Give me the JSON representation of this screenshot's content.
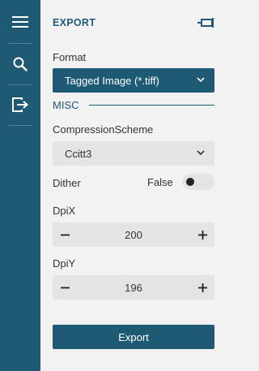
{
  "sidebar": {
    "accent": "#1f5a75",
    "icons": [
      "menu-icon",
      "search-icon",
      "export-icon"
    ]
  },
  "panel": {
    "title": "EXPORT",
    "pin_icon": "pin-icon"
  },
  "format": {
    "label": "Format",
    "selected": "Tagged Image (*.tiff)"
  },
  "misc": {
    "label": "MISC"
  },
  "compression": {
    "label": "CompressionScheme",
    "selected": "Ccitt3"
  },
  "dither": {
    "label": "Dither",
    "value": "False",
    "enabled": false
  },
  "dpix": {
    "label": "DpiX",
    "value": "200"
  },
  "dpiy": {
    "label": "DpiY",
    "value": "196"
  },
  "export_button": {
    "label": "Export"
  },
  "colors": {
    "primary": "#1f5a75",
    "panel_bg": "#f2f2f2",
    "field_bg": "#e4e4e4"
  }
}
